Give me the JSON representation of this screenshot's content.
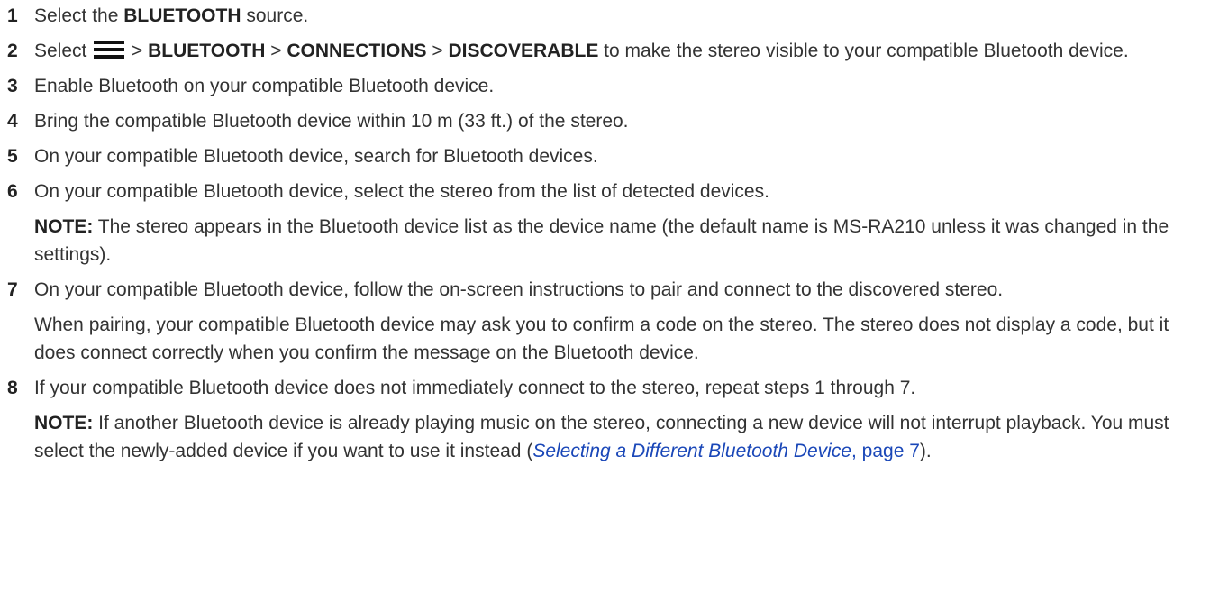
{
  "steps": [
    {
      "num": "1",
      "pre": "Select the ",
      "bold": "BLUETOOTH",
      "post": " source."
    },
    {
      "num": "2",
      "pre": "Select ",
      "sep1": " > ",
      "b1": "BLUETOOTH",
      "sep2": " > ",
      "b2": "CONNECTIONS",
      "sep3": " > ",
      "b3": "DISCOVERABLE",
      "post": " to make the stereo visible to your compatible Bluetooth device.",
      "icon": "menu-icon"
    },
    {
      "num": "3",
      "text": "Enable Bluetooth on your compatible Bluetooth device."
    },
    {
      "num": "4",
      "text": "Bring the compatible Bluetooth device within 10 m (33 ft.) of the stereo."
    },
    {
      "num": "5",
      "text": "On your compatible Bluetooth device, search for Bluetooth devices."
    },
    {
      "num": "6",
      "text": "On your compatible Bluetooth device, select the stereo from the list of detected devices.",
      "note_label": "NOTE:",
      "note_text": " The stereo appears in the Bluetooth device list as the device name (the default name is MS-RA210 unless it was changed in the settings)."
    },
    {
      "num": "7",
      "text": "On your compatible Bluetooth device, follow the on-screen instructions to pair and connect to the discovered stereo.",
      "para": "When pairing, your compatible Bluetooth device may ask you to confirm a code on the stereo. The stereo does not display a code, but it does connect correctly when you confirm the message on the Bluetooth device."
    },
    {
      "num": "8",
      "text": "If your compatible Bluetooth device does not immediately connect to the stereo, repeat steps 1 through 7.",
      "note_label": "NOTE:",
      "note_text": " If another Bluetooth device is already playing music on the stereo, connecting a new device will not interrupt playback. You must select the newly-added device if you want to use it instead (",
      "link_text": "Selecting a Different Bluetooth Device",
      "link_page": ", page 7",
      "note_end": ")."
    }
  ],
  "colors": {
    "text": "#333333",
    "link": "#1a47b8"
  }
}
